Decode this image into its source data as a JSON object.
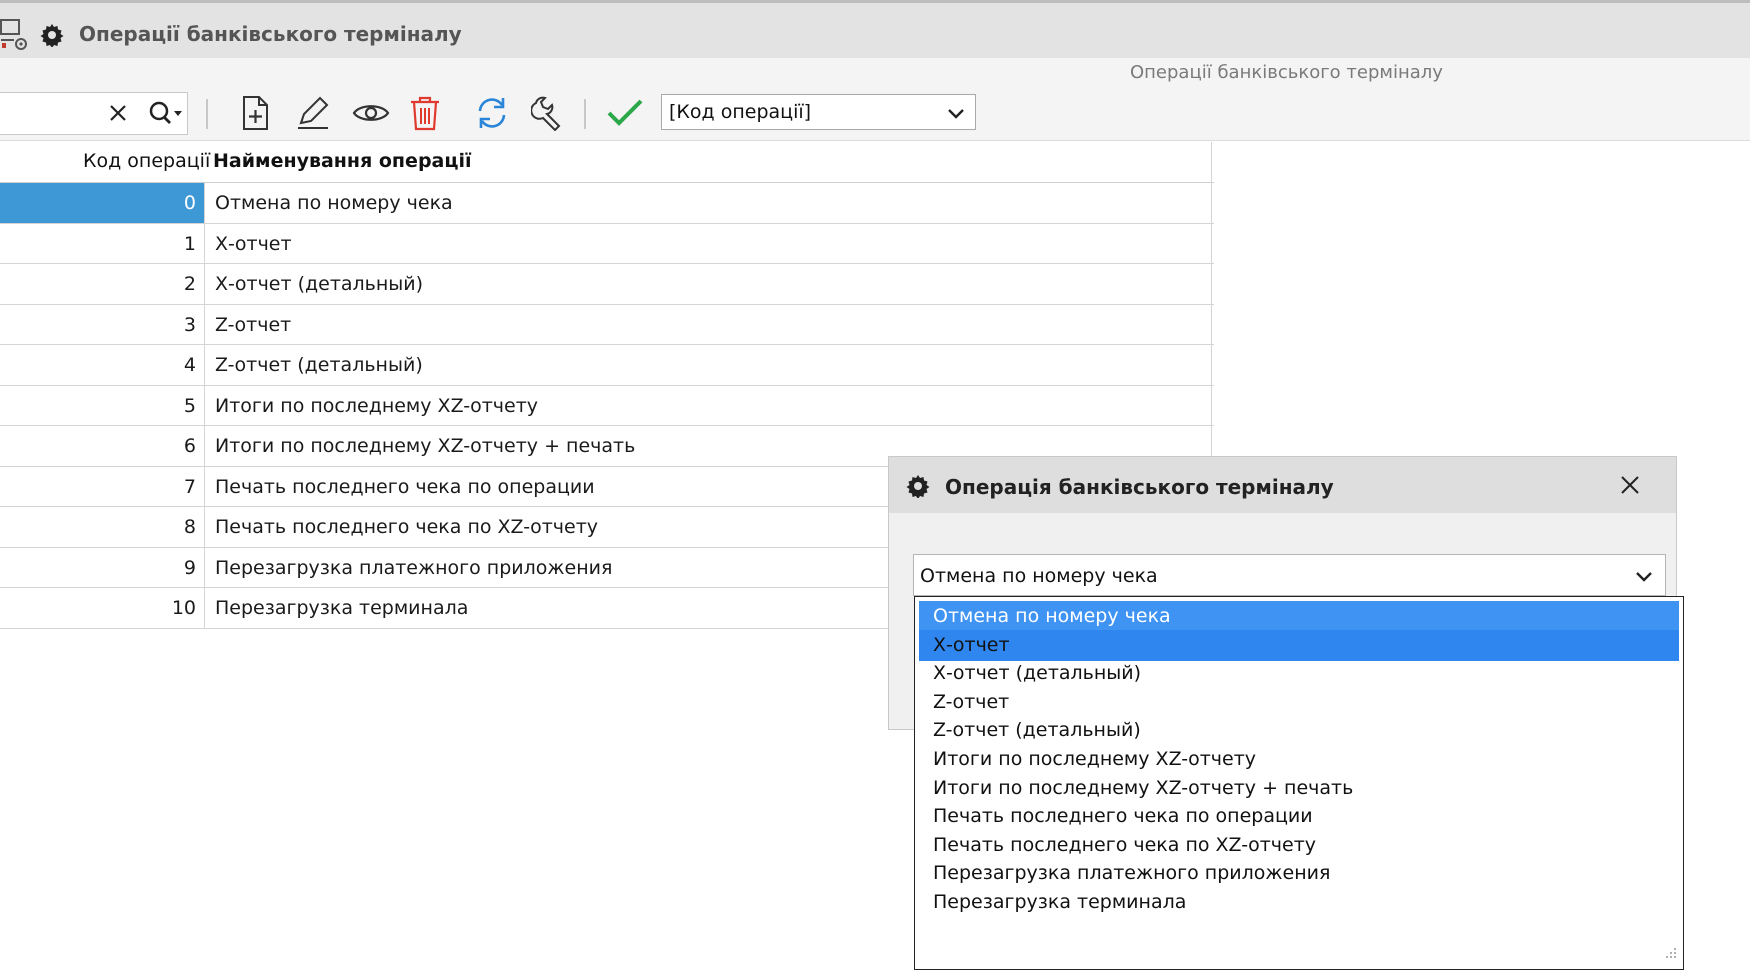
{
  "window": {
    "title": "Операції банківського терміналу",
    "subtitle": "Операції банківського терміналу"
  },
  "toolbar": {
    "search_value": "",
    "sort_combo_value": "[Код операції]"
  },
  "table": {
    "columns": [
      "Код операції",
      "Найменування операції"
    ],
    "rows": [
      {
        "code": "0",
        "name": "Отмена по номеру чека"
      },
      {
        "code": "1",
        "name": "Х-отчет"
      },
      {
        "code": "2",
        "name": "Х-отчет (детальный)"
      },
      {
        "code": "3",
        "name": "Z-отчет"
      },
      {
        "code": "4",
        "name": "Z-отчет (детальный)"
      },
      {
        "code": "5",
        "name": "Итоги по последнему XZ-отчету"
      },
      {
        "code": "6",
        "name": "Итоги по последнему XZ-отчету + печать"
      },
      {
        "code": "7",
        "name": "Печать последнего чека по операции"
      },
      {
        "code": "8",
        "name": "Печать последнего чека по XZ-отчету"
      },
      {
        "code": "9",
        "name": "Перезагрузка платежного приложения"
      },
      {
        "code": "10",
        "name": "Перезагрузка терминала"
      }
    ]
  },
  "dialog": {
    "title": "Операція банківського терміналу",
    "combo_value": "Отмена по номеру чека",
    "options": [
      "Отмена по номеру чека",
      "Х-отчет",
      "Х-отчет (детальный)",
      "Z-отчет",
      "Z-отчет (детальный)",
      "Итоги по последнему XZ-отчету",
      "Итоги по последнему XZ-отчету + печать",
      "Печать последнего чека по операции",
      "Печать последнего чека по XZ-отчету",
      "Перезагрузка платежного приложения",
      "Перезагрузка терминала"
    ]
  },
  "colors": {
    "selection": "#3f98d6",
    "dropdown_highlight": "#3e93f3",
    "delete_icon": "#e03a2f",
    "refresh_icon": "#2a86d8",
    "check_icon": "#2aa84a"
  }
}
